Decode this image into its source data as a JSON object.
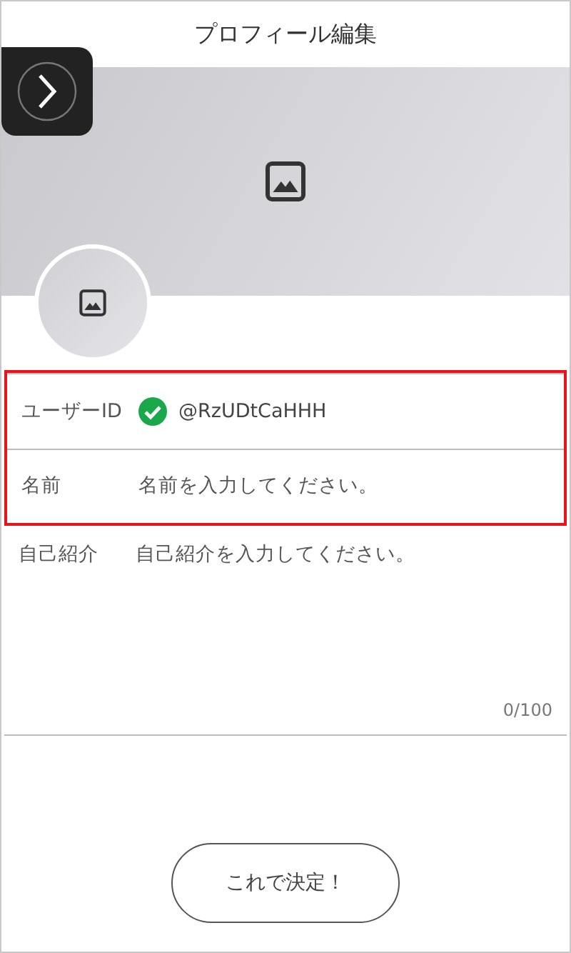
{
  "header": {
    "title": "プロフィール編集"
  },
  "fields": [
    {
      "kind": "verified",
      "label": "ユーザーID",
      "value": "@RzUDtCaHHH",
      "verified": true,
      "highlighted": true
    },
    {
      "kind": "input",
      "label": "名前",
      "placeholder": "名前を入力してください。",
      "highlighted": true
    },
    {
      "kind": "textarea",
      "label": "自己紹介",
      "placeholder": "自己紹介を入力してください。",
      "counter": "0/100",
      "highlighted": false
    }
  ],
  "submit": {
    "label": "これで決定！"
  }
}
